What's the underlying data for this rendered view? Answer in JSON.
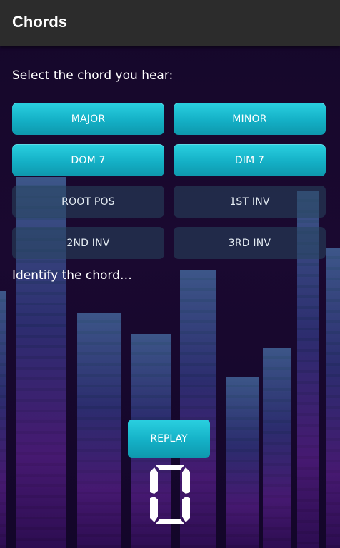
{
  "appbar": {
    "title": "Chords"
  },
  "prompt": "Select the chord you hear:",
  "buttons": [
    {
      "label": "MAJOR",
      "state": "active"
    },
    {
      "label": "MINOR",
      "state": "active"
    },
    {
      "label": "DOM 7",
      "state": "active"
    },
    {
      "label": "DIM 7",
      "state": "active"
    },
    {
      "label": "ROOT POS",
      "state": "inactive"
    },
    {
      "label": "1ST INV",
      "state": "inactive"
    },
    {
      "label": "2ND INV",
      "state": "inactive"
    },
    {
      "label": "3RD INV",
      "state": "inactive"
    }
  ],
  "status": "Identify the chord…",
  "replay": {
    "label": "REPLAY"
  },
  "score": {
    "value": "0"
  },
  "colors": {
    "accent": "#14b0c6",
    "appbar": "#2c2c2c",
    "background": "#15072a"
  }
}
